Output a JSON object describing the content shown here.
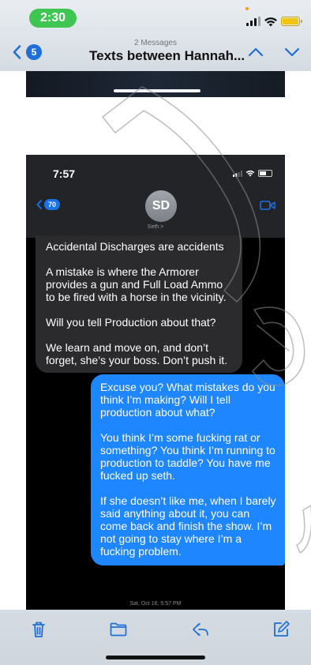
{
  "status_bar": {
    "time": "2:30"
  },
  "nav": {
    "subtitle": "2 Messages",
    "title": "Texts between Hannah...",
    "back_badge": "5"
  },
  "inner": {
    "time": "7:57",
    "back_badge": "70",
    "avatar_initials": "SD",
    "contact_name": "Seth >",
    "incoming_message": [
      "Accidental Discharges are accidents",
      "A mistake is where the Armorer provides a gun and Full Load Ammo to be fired with a horse in the vicinity.",
      "Will you tell Production about that?",
      "We learn and move on, and don’t forget, she’s your boss. Don’t push it."
    ],
    "outgoing_message": [
      "Excuse you? What mistakes do you think I’m making? Will I tell production about what?",
      "You think I’m some fucking rat or something? You think I’m running to production to taddle? You have me fucked up seth.",
      "If she doesn’t like me, when I barely said anything about it, you can come back and finish the show. I’m not going to stay where I’m a fucking problem."
    ],
    "timestamp": "Sat, Oct 16, 5:57 PM"
  },
  "colors": {
    "accent": "#1f6fd8",
    "outgoing_bubble": "#1e86ff",
    "incoming_bubble": "#2b2b2d",
    "status_pill": "#3fc552"
  },
  "toolbar": {
    "icons": [
      "trash-icon",
      "folder-icon",
      "reply-icon",
      "compose-icon"
    ]
  }
}
